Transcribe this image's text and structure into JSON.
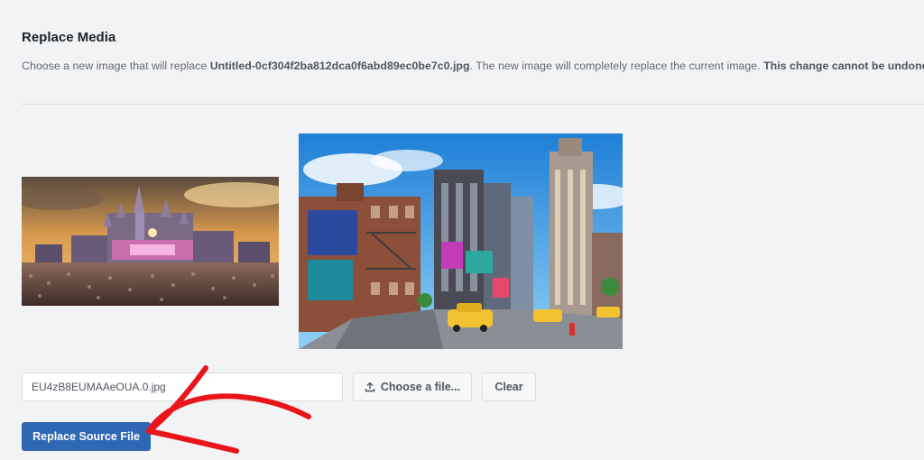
{
  "header": {
    "title": "Replace Media"
  },
  "description": {
    "prefix": "Choose a new image that will replace ",
    "filename": "Untitled-0cf304f2ba812dca0f6abd89ec0be7c0.jpg",
    "middle": ". The new image will completely replace the current image. ",
    "warning": "This change cannot be undone."
  },
  "upload": {
    "selected_file": "EU4zB8EUMAAeOUA.0.jpg",
    "choose_label": "Choose a file...",
    "clear_label": "Clear",
    "choose_icon": "upload-icon"
  },
  "actions": {
    "replace_label": "Replace Source File"
  },
  "colors": {
    "primary": "#2f67b3",
    "annotation_arrow": "#e8151b",
    "background": "#f2f3f5"
  }
}
